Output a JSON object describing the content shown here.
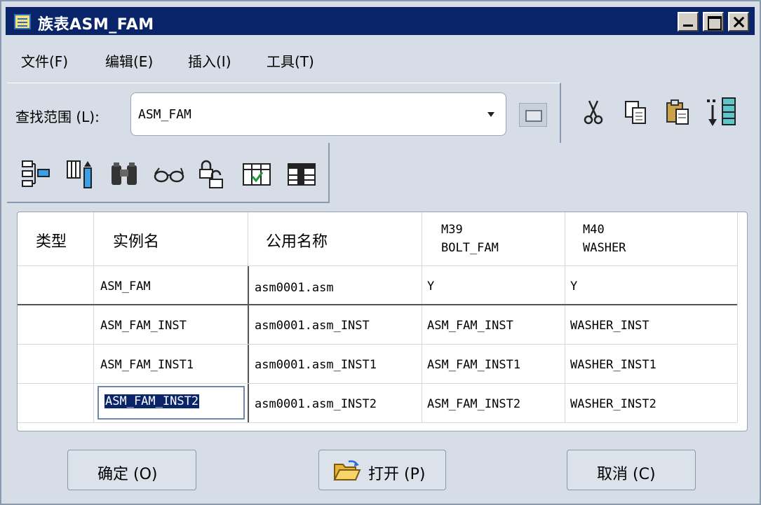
{
  "window": {
    "title": "族表ASM_FAM"
  },
  "menu": [
    {
      "label": "文件(F)"
    },
    {
      "label": "编辑(E)"
    },
    {
      "label": "插入(I)"
    },
    {
      "label": "工具(T)"
    }
  ],
  "find": {
    "label": "查找范围 (L):",
    "value": "ASM_FAM"
  },
  "table": {
    "headers": [
      "类型",
      "实例名",
      "公用名称",
      "M39\nBOLT_FAM",
      "M40\nWASHER"
    ],
    "rows": [
      {
        "type": "",
        "instance": "ASM_FAM",
        "common": "asm0001.asm",
        "m39": "Y",
        "m40": "Y"
      },
      {
        "type": "",
        "instance": "ASM_FAM_INST",
        "common": "asm0001.asm_INST",
        "m39": "ASM_FAM_INST",
        "m40": "WASHER_INST"
      },
      {
        "type": "",
        "instance": "ASM_FAM_INST1",
        "common": "asm0001.asm_INST1",
        "m39": "ASM_FAM_INST1",
        "m40": "WASHER_INST1"
      },
      {
        "type": "",
        "instance": "ASM_FAM_INST2",
        "common": "asm0001.asm_INST2",
        "m39": "ASM_FAM_INST2",
        "m40": "WASHER_INST2"
      }
    ]
  },
  "buttons": {
    "ok": "确定 (O)",
    "open": "打开 (P)",
    "cancel": "取消 (C)"
  },
  "icons": [
    "cut-icon",
    "copy-icon",
    "paste-icon",
    "insert-column-icon",
    "tree-icon",
    "add-column-icon",
    "binoculars-icon",
    "glasses-icon",
    "lock-icon",
    "verify-icon",
    "table-icon",
    "folder-open-icon"
  ],
  "colors": {
    "titlebar": "#0a246a",
    "selection": "#0a246a",
    "window": "#d6dde6"
  }
}
